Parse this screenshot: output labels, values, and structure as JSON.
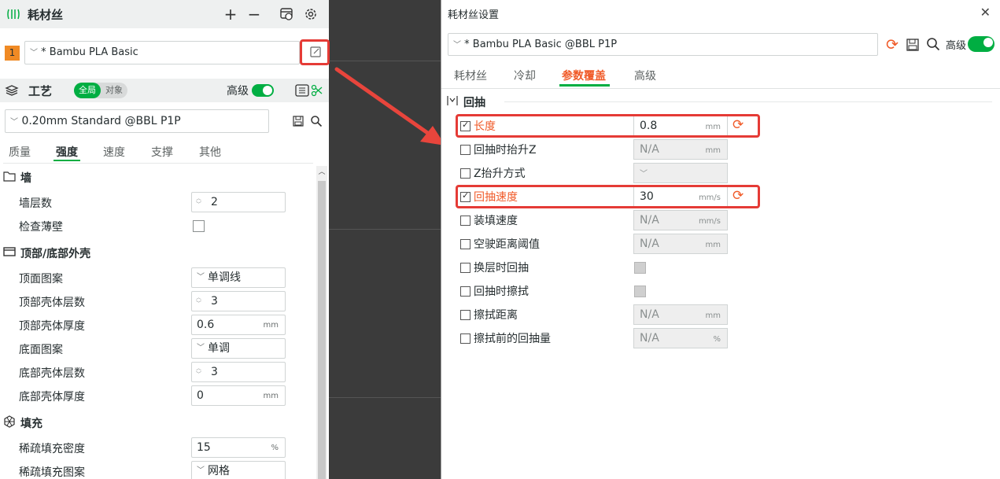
{
  "left": {
    "header": {
      "title": "耗材丝"
    },
    "filament": {
      "index": "1",
      "preset": "* Bambu PLA Basic"
    },
    "process": {
      "title": "工艺",
      "scope_global": "全局",
      "scope_object": "对象",
      "advanced_label": "高级",
      "preset": "0.20mm Standard @BBL P1P"
    },
    "tabs": [
      "质量",
      "强度",
      "速度",
      "支撑",
      "其他"
    ],
    "sections": {
      "wall": {
        "title": "墙",
        "wall_loops_label": "墙层数",
        "wall_loops_value": "2",
        "detect_thin_wall_label": "检查薄壁"
      },
      "shell": {
        "title": "顶部/底部外壳",
        "top_pattern_label": "顶面图案",
        "top_pattern_value": "单调线",
        "top_layers_label": "顶部壳体层数",
        "top_layers_value": "3",
        "top_thickness_label": "顶部壳体厚度",
        "top_thickness_value": "0.6",
        "top_thickness_unit": "mm",
        "bottom_pattern_label": "底面图案",
        "bottom_pattern_value": "单调",
        "bottom_layers_label": "底部壳体层数",
        "bottom_layers_value": "3",
        "bottom_thickness_label": "底部壳体厚度",
        "bottom_thickness_value": "0",
        "bottom_thickness_unit": "mm"
      },
      "infill": {
        "title": "填充",
        "density_label": "稀疏填充密度",
        "density_value": "15",
        "density_unit": "%",
        "pattern_label": "稀疏填充图案",
        "pattern_value": "网格"
      }
    }
  },
  "dialog": {
    "title": "耗材丝设置",
    "close": "✕",
    "preset": "* Bambu PLA Basic @BBL P1P",
    "advanced_label": "高级",
    "tabs": [
      "耗材丝",
      "冷却",
      "参数覆盖",
      "高级"
    ],
    "section_title": "回抽",
    "rows": [
      {
        "label": "长度",
        "value": "0.8",
        "unit": "mm"
      },
      {
        "label": "回抽时抬升Z",
        "value": "N/A",
        "unit": "mm"
      },
      {
        "label": "Z抬升方式",
        "value": ""
      },
      {
        "label": "回抽速度",
        "value": "30",
        "unit": "mm/s"
      },
      {
        "label": "装填速度",
        "value": "N/A",
        "unit": "mm/s"
      },
      {
        "label": "空驶距离阈值",
        "value": "N/A",
        "unit": "mm"
      },
      {
        "label": "换层时回抽"
      },
      {
        "label": "回抽时擦拭"
      },
      {
        "label": "擦拭距离",
        "value": "N/A",
        "unit": "mm"
      },
      {
        "label": "擦拭前的回抽量",
        "value": "N/A",
        "unit": "%"
      }
    ]
  },
  "colors": {
    "accent_green": "#00ae42",
    "accent_orange": "#f05a28",
    "highlight_red": "#e53b36",
    "filament_swatch": "#f08a24"
  }
}
